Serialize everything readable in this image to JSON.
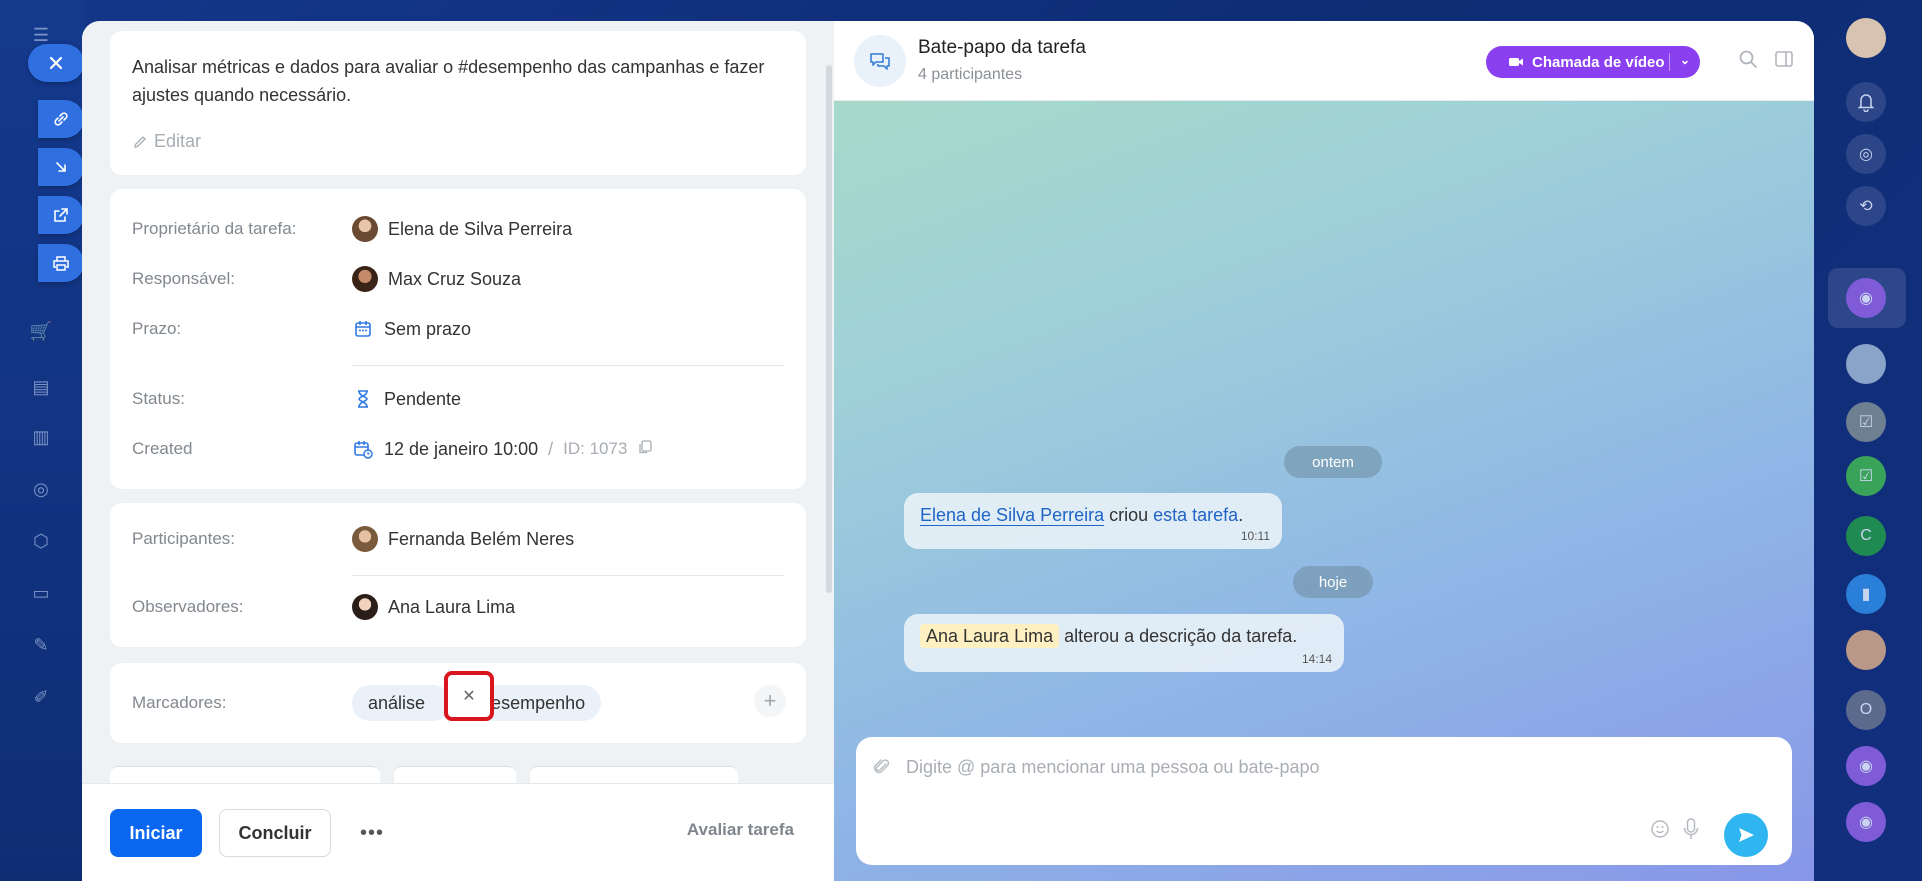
{
  "description": {
    "text": "Analisar métricas e dados para avaliar o #desempenho das campanhas e fazer ajustes quando necessário.",
    "edit_label": "Editar"
  },
  "info": {
    "owner_label": "Proprietário da tarefa:",
    "owner_name": "Elena de Silva Perreira",
    "responsible_label": "Responsável:",
    "responsible_name": "Max Cruz Souza",
    "deadline_label": "Prazo:",
    "deadline_value": "Sem prazo",
    "status_label": "Status:",
    "status_value": "Pendente",
    "created_label": "Created",
    "created_value": "12 de janeiro 10:00",
    "id_sep": "/",
    "id_value": "ID: 1073"
  },
  "participants": {
    "participants_label": "Participantes:",
    "participants_name": "Fernanda Belém Neres",
    "observers_label": "Observadores:",
    "observers_name": "Ana Laura Lima"
  },
  "tags": {
    "label": "Marcadores:",
    "items": [
      "análise",
      "desempenho"
    ]
  },
  "footer": {
    "start_label": "Iniciar",
    "complete_label": "Concluir",
    "more_label": "•••",
    "rate_label": "Avaliar tarefa"
  },
  "chat": {
    "title": "Bate-papo da tarefa",
    "subtitle": "4 participantes",
    "video_call_label": "Chamada de vídeo",
    "date_yesterday": "ontem",
    "date_today": "hoje",
    "msg1": {
      "author": "Elena de Silva Perreira",
      "verb": " criou ",
      "link": "esta tarefa",
      "tail": ".",
      "time": "10:11"
    },
    "msg2": {
      "author": "Ana Laura Lima",
      "text": " alterou a descrição da tarefa.",
      "time": "14:14"
    },
    "composer_placeholder": "Digite @ para mencionar uma pessoa ou bate-papo"
  },
  "right_rail": {
    "letters": [
      "C",
      "O"
    ]
  },
  "colors": {
    "primary": "#0b66f0",
    "video": "#8a3ff0",
    "send": "#2fb6f0",
    "highlight": "#d9161d"
  }
}
